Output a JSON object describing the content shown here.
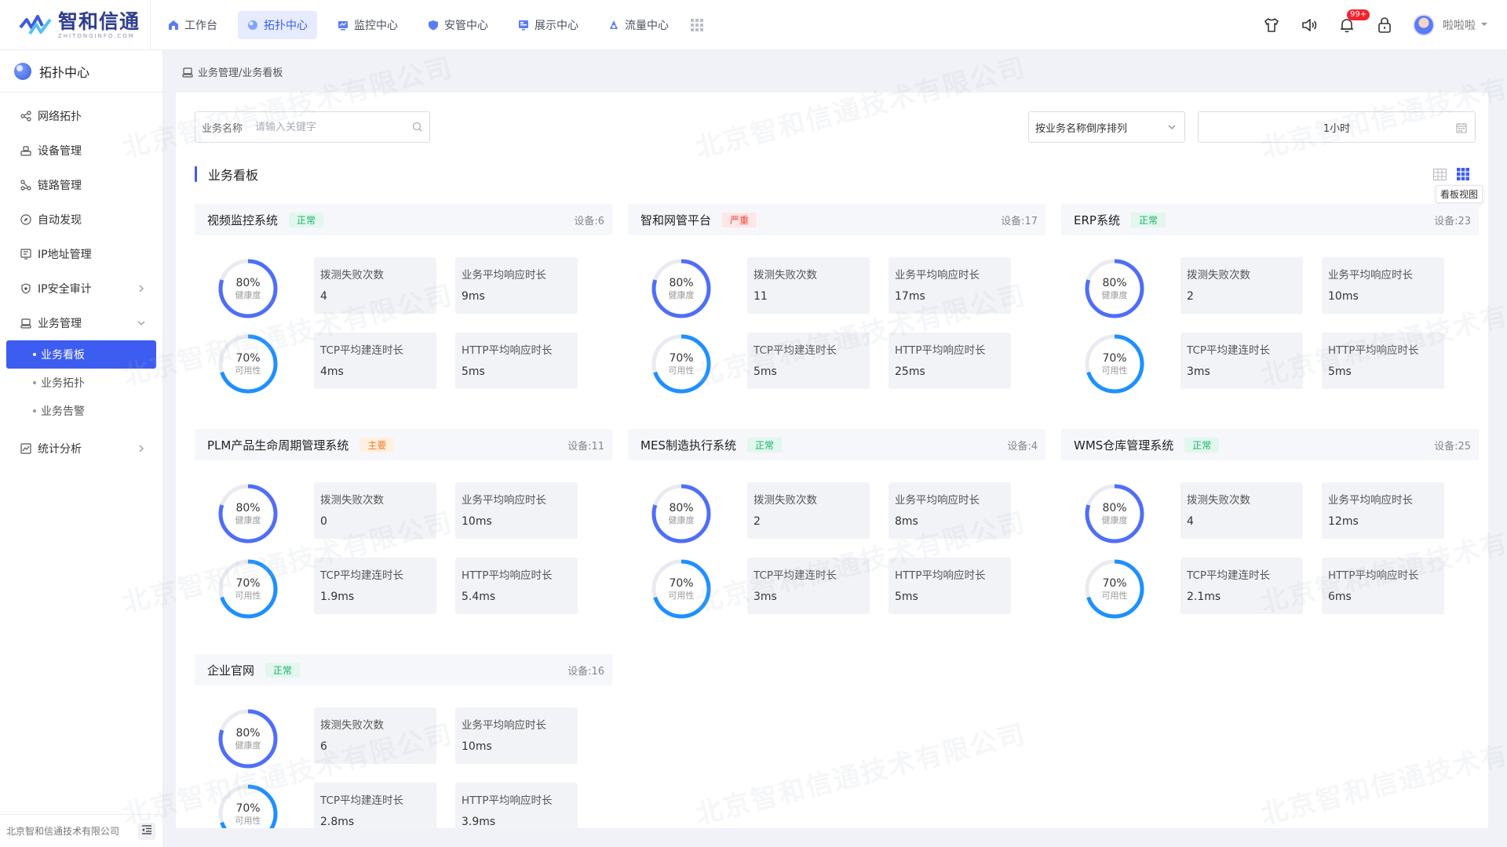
{
  "brand": {
    "name": "智和信通",
    "subtitle": "ZHITONGINFO.COM"
  },
  "nav": [
    {
      "label": "工作台",
      "icon": "home-icon",
      "active": false
    },
    {
      "label": "拓扑中心",
      "icon": "topology-icon",
      "active": true
    },
    {
      "label": "监控中心",
      "icon": "monitor-icon",
      "active": false
    },
    {
      "label": "安管中心",
      "icon": "shield-icon",
      "active": false
    },
    {
      "label": "展示中心",
      "icon": "display-icon",
      "active": false
    },
    {
      "label": "流量中心",
      "icon": "flow-icon",
      "active": false
    }
  ],
  "header_tools": {
    "notification_badge": "99+",
    "user_name": "啦啦啦"
  },
  "sidebar": {
    "title": "拓扑中心",
    "items": [
      {
        "label": "网络拓扑",
        "icon": "network-topology-icon"
      },
      {
        "label": "设备管理",
        "icon": "device-icon"
      },
      {
        "label": "链路管理",
        "icon": "link-icon"
      },
      {
        "label": "自动发现",
        "icon": "compass-icon"
      },
      {
        "label": "IP地址管理",
        "icon": "ip-address-icon"
      },
      {
        "label": "IP安全审计",
        "icon": "security-audit-icon",
        "expandable": true
      },
      {
        "label": "业务管理",
        "icon": "business-icon",
        "expanded": true
      }
    ],
    "sub_items": [
      {
        "label": "业务看板",
        "active": true
      },
      {
        "label": "业务拓扑",
        "active": false
      },
      {
        "label": "业务告警",
        "active": false
      }
    ],
    "after_items": [
      {
        "label": "统计分析",
        "icon": "stats-icon",
        "expandable": true
      }
    ],
    "footer": "北京智和信通技术有限公司"
  },
  "breadcrumb": "业务管理/业务看板",
  "filters": {
    "search_label": "业务名称",
    "search_placeholder": "请输入关键字",
    "sort_value": "按业务名称倒序排列",
    "time_value": "1小时"
  },
  "section_title": "业务看板",
  "view_tooltip": "看板视图",
  "colors": {
    "accent": "#3d5cf0",
    "ok": "#17b26a",
    "critical": "#f04438",
    "major": "#f27c22",
    "health_ring": "#4f6ef7",
    "avail_ring": "#1e90ff"
  },
  "metric_labels": {
    "fail": "拨测失败次数",
    "resp": "业务平均响应时长",
    "tcp": "TCP平均建连时长",
    "http": "HTTP平均响应时长",
    "health": "健康度",
    "avail": "可用性"
  },
  "cards": [
    {
      "name": "视频监控系统",
      "status": "正常",
      "status_type": "ok",
      "devices": "设备:6",
      "health": "80%",
      "health_pct": 80,
      "avail": "70%",
      "avail_pct": 70,
      "fail": "4",
      "resp": "9ms",
      "tcp": "4ms",
      "http": "5ms"
    },
    {
      "name": "智和网管平台",
      "status": "严重",
      "status_type": "bad",
      "devices": "设备:17",
      "health": "80%",
      "health_pct": 80,
      "avail": "70%",
      "avail_pct": 70,
      "fail": "11",
      "resp": "17ms",
      "tcp": "5ms",
      "http": "25ms"
    },
    {
      "name": "ERP系统",
      "status": "正常",
      "status_type": "ok",
      "devices": "设备:23",
      "health": "80%",
      "health_pct": 80,
      "avail": "70%",
      "avail_pct": 70,
      "fail": "2",
      "resp": "10ms",
      "tcp": "3ms",
      "http": "5ms"
    },
    {
      "name": "PLM产品生命周期管理系统",
      "status": "主要",
      "status_type": "main",
      "devices": "设备:11",
      "health": "80%",
      "health_pct": 80,
      "avail": "70%",
      "avail_pct": 70,
      "fail": "0",
      "resp": "10ms",
      "tcp": "1.9ms",
      "http": "5.4ms"
    },
    {
      "name": "MES制造执行系统",
      "status": "正常",
      "status_type": "ok",
      "devices": "设备:4",
      "health": "80%",
      "health_pct": 80,
      "avail": "70%",
      "avail_pct": 70,
      "fail": "2",
      "resp": "8ms",
      "tcp": "3ms",
      "http": "5ms"
    },
    {
      "name": "WMS仓库管理系统",
      "status": "正常",
      "status_type": "ok",
      "devices": "设备:25",
      "health": "80%",
      "health_pct": 80,
      "avail": "70%",
      "avail_pct": 70,
      "fail": "4",
      "resp": "12ms",
      "tcp": "2.1ms",
      "http": "6ms"
    },
    {
      "name": "企业官网",
      "status": "正常",
      "status_type": "ok",
      "devices": "设备:16",
      "health": "80%",
      "health_pct": 80,
      "avail": "70%",
      "avail_pct": 70,
      "fail": "6",
      "resp": "10ms",
      "tcp": "2.8ms",
      "http": "3.9ms"
    }
  ],
  "watermark": "北京智和信通技术有限公司"
}
